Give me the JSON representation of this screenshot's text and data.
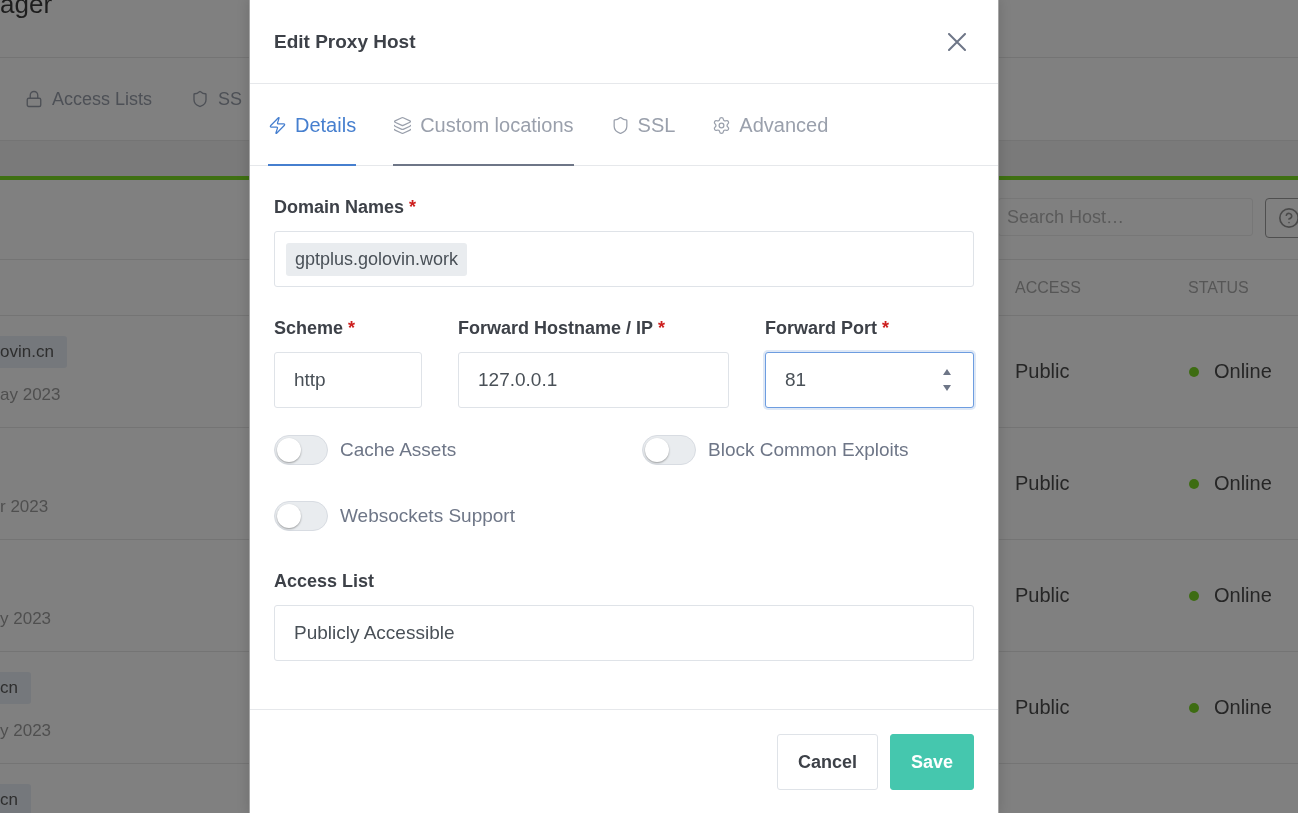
{
  "page": {
    "title": "ager",
    "nav": [
      {
        "label": "Access Lists",
        "selected": false
      },
      {
        "label": "SS",
        "selected": false
      }
    ],
    "search": {
      "placeholder": "Search Host…"
    },
    "table": {
      "columns": [
        "ACCESS",
        "STATUS"
      ],
      "rows": [
        {
          "badge": "ovin.cn",
          "date": "ay 2023",
          "access": "Public",
          "status": "Online"
        },
        {
          "date": "r 2023",
          "access": "Public",
          "status": "Online"
        },
        {
          "date": "y 2023",
          "access": "Public",
          "status": "Online"
        },
        {
          "badge": "cn",
          "date": "y 2023",
          "access": "Public",
          "status": "Online"
        },
        {
          "badge": "cn"
        }
      ]
    }
  },
  "modal": {
    "title": "Edit Proxy Host",
    "tabs": [
      {
        "label": "Details",
        "selected": true,
        "hovered": false
      },
      {
        "label": "Custom locations",
        "selected": false,
        "hovered": true
      },
      {
        "label": "SSL",
        "selected": false,
        "hovered": false
      },
      {
        "label": "Advanced",
        "selected": false,
        "hovered": false
      }
    ],
    "domain_names": {
      "label": "Domain Names",
      "mark": "*",
      "chips": [
        "gptplus.golovin.work"
      ]
    },
    "forward_fields": [
      {
        "label": "Scheme",
        "mark": "*",
        "value": "http",
        "kind": "text",
        "focused": false
      },
      {
        "label": "Forward Hostname / IP",
        "mark": "*",
        "value": "127.0.0.1",
        "kind": "text",
        "focused": false
      },
      {
        "label": "Forward Port",
        "mark": "*",
        "value": "81",
        "kind": "number",
        "focused": true
      }
    ],
    "switches": [
      {
        "label": "Cache Assets",
        "on": false
      },
      {
        "label": "Block Common Exploits",
        "on": false
      },
      {
        "label": "Websockets Support",
        "on": false
      }
    ],
    "access_list": {
      "label": "Access List",
      "value": "Publicly Accessible"
    },
    "buttons": [
      {
        "label": "Cancel",
        "kind": "secondary"
      },
      {
        "label": "Save",
        "kind": "primary"
      }
    ]
  }
}
